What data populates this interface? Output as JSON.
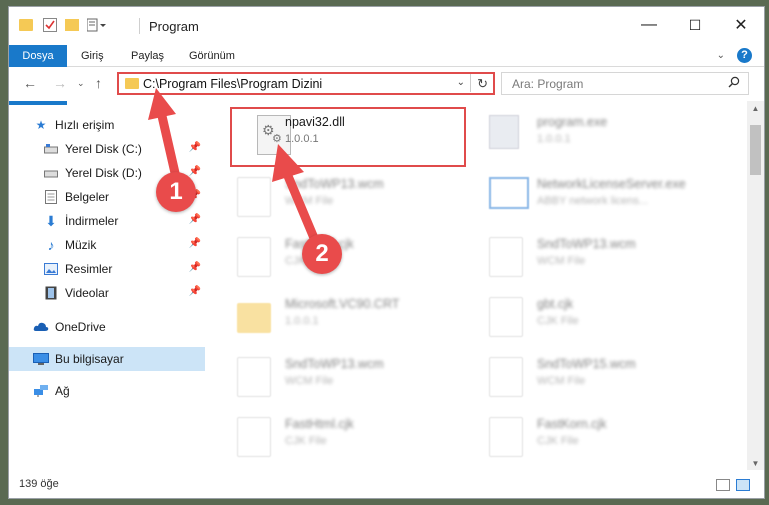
{
  "window": {
    "title": "Program"
  },
  "window_controls": {
    "minimize": "—",
    "maximize": "☐",
    "close": "✕"
  },
  "ribbon": {
    "tabs": [
      {
        "label": "Dosya"
      },
      {
        "label": "Giriş"
      },
      {
        "label": "Paylaş"
      },
      {
        "label": "Görünüm"
      }
    ],
    "help_label": "?"
  },
  "address_bar": {
    "path": "C:\\Program Files\\Program Dizini"
  },
  "search": {
    "placeholder": "Ara: Program"
  },
  "sidebar": {
    "items": [
      {
        "label": "Hızlı erişim"
      },
      {
        "label": "Yerel Disk (C:)"
      },
      {
        "label": "Yerel Disk (D:)"
      },
      {
        "label": "Belgeler"
      },
      {
        "label": "İndirmeler"
      },
      {
        "label": "Müzik"
      },
      {
        "label": "Resimler"
      },
      {
        "label": "Videolar"
      },
      {
        "label": "OneDrive"
      },
      {
        "label": "Bu bilgisayar"
      },
      {
        "label": "Ağ"
      }
    ]
  },
  "files": [
    {
      "name": "npavi32.dll",
      "sub": "1.0.0.1"
    },
    {
      "name": "program.exe",
      "sub": "1.0.0.1"
    },
    {
      "name": "SndToWP13.wcm",
      "sub": "WCM File"
    },
    {
      "name": "NetworkLicenseServer.exe",
      "sub": "ABBY network licens..."
    },
    {
      "name": "FastHtml.cjk",
      "sub": "CJK File"
    },
    {
      "name": "SndToWP13.wcm",
      "sub": "WCM File"
    },
    {
      "name": "Microsoft.VC90.CRT",
      "sub": "1.0.0.1"
    },
    {
      "name": "gbt.cjk",
      "sub": "CJK File"
    },
    {
      "name": "SndToWP13.wcm",
      "sub": "WCM File"
    },
    {
      "name": "SndToWP15.wcm",
      "sub": "WCM File"
    },
    {
      "name": "FastHtml.cjk",
      "sub": "CJK File"
    },
    {
      "name": "FastKorn.cjk",
      "sub": "CJK File"
    }
  ],
  "status": {
    "count": "139 öğe"
  },
  "callouts": {
    "one": "1",
    "two": "2"
  },
  "colors": {
    "accent": "#1979ca",
    "highlight": "#e04b4b",
    "badge": "#e94b4b",
    "folder": "#f5c955"
  }
}
